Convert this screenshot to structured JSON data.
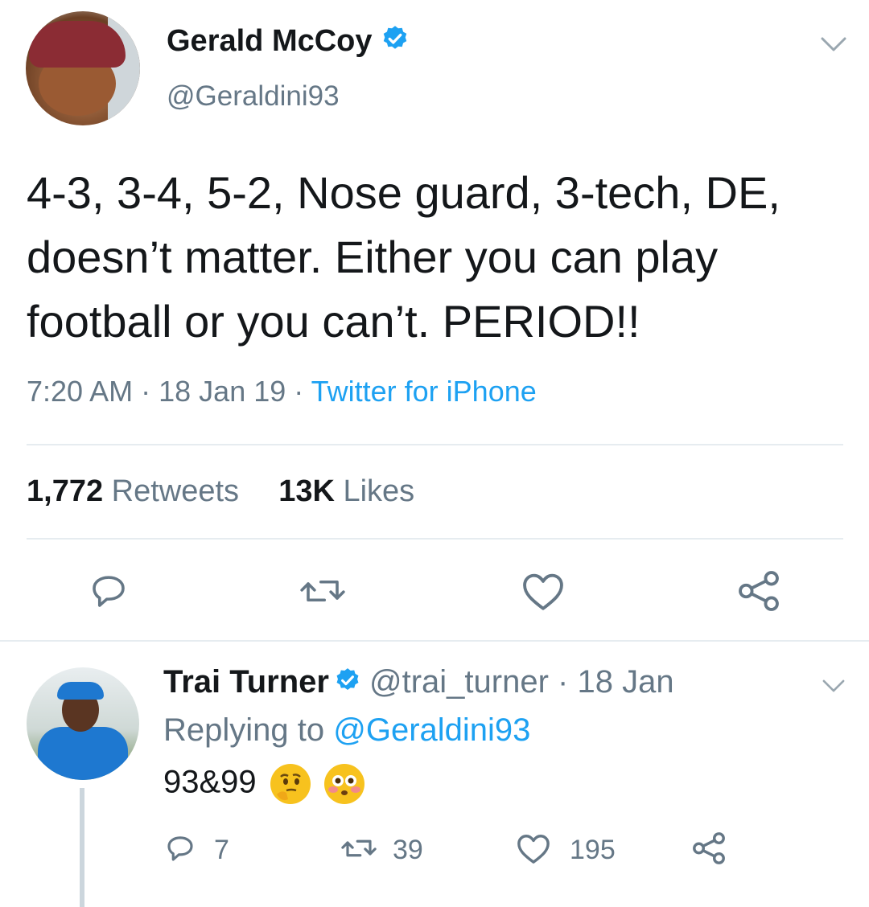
{
  "tweet": {
    "author_name": "Gerald McCoy",
    "handle": "@Geraldini93",
    "text": "4-3, 3-4, 5-2, Nose guard, 3-tech, DE, doesn’t matter. Either you can play football or you can’t. PERIOD!!",
    "time": "7:20 AM",
    "date": "18 Jan 19",
    "separator": "·",
    "source": "Twitter for iPhone",
    "retweets_count": "1,772",
    "retweets_label": "Retweets",
    "likes_count": "13K",
    "likes_label": "Likes"
  },
  "reply": {
    "author_name": "Trai Turner",
    "handle": "@trai_turner",
    "date": "18 Jan",
    "separator": "·",
    "replying_prefix": "Replying to",
    "replying_mention": "@Geraldini93",
    "text": "93&99",
    "emojis": [
      "thinking-face",
      "flushed-face"
    ],
    "reply_count": "7",
    "retweet_count": "39",
    "like_count": "195"
  },
  "colors": {
    "link": "#1da1f2",
    "secondary_text": "#657786",
    "divider": "#e6ecf0",
    "verified": "#1da1f2"
  }
}
